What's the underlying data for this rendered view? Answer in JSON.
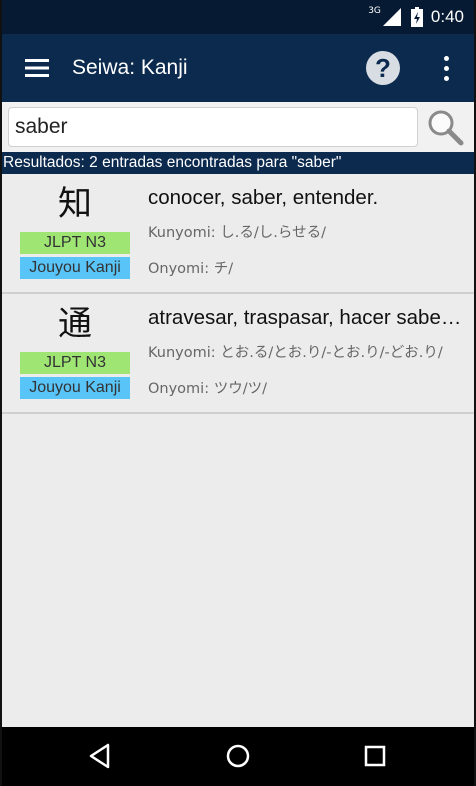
{
  "status_bar": {
    "network": "3G",
    "time": "0:40"
  },
  "app_bar": {
    "title": "Seiwa: Kanji",
    "help_label": "?"
  },
  "search": {
    "value": "saber"
  },
  "results": {
    "summary": "Resultados: 2 entradas encontradas para \"saber\"",
    "entries": [
      {
        "kanji": "知",
        "jlpt": "JLPT N3",
        "grade": "Jouyou Kanji",
        "meaning": "conocer, saber, entender.",
        "kunyomi": "Kunyomi: し.る/し.らせる/",
        "onyomi": "Onyomi: チ/"
      },
      {
        "kanji": "通",
        "jlpt": "JLPT N3",
        "grade": "Jouyou Kanji",
        "meaning": "atravesar, traspasar, hacer saber, transitar.",
        "kunyomi": "Kunyomi: とお.る/とお.り/-とお.り/-どお.り/",
        "onyomi": "Onyomi: ツウ/ツ/"
      }
    ]
  },
  "colors": {
    "app_bar": "#0b2a4e",
    "jlpt_badge": "#9fe573",
    "jouyou_badge": "#59c4f7"
  },
  "icons": [
    "menu-icon",
    "help-icon",
    "overflow-menu-icon",
    "search-icon",
    "back-icon",
    "home-icon",
    "recents-icon",
    "signal-icon",
    "battery-icon"
  ]
}
